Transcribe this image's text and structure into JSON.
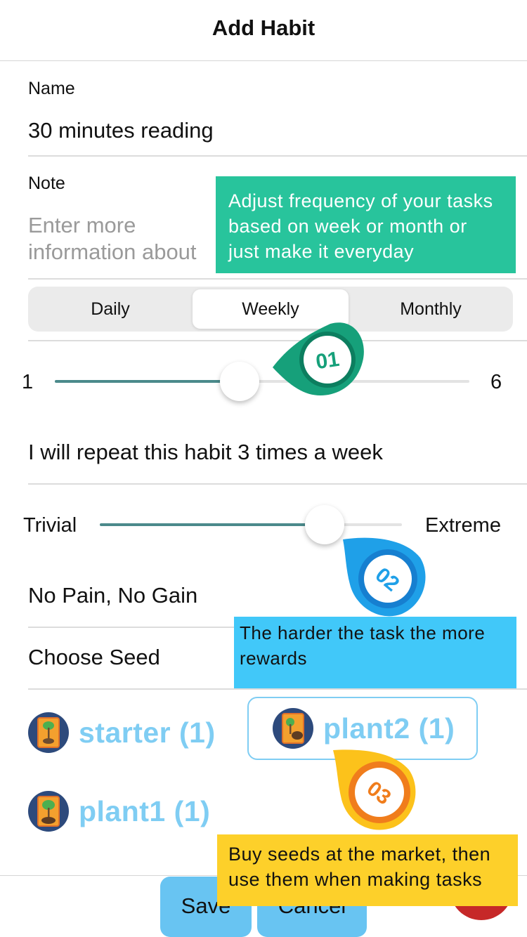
{
  "header": {
    "title": "Add Habit"
  },
  "form": {
    "name_label": "Name",
    "name_value": "30 minutes reading",
    "note_label": "Note",
    "note_placeholder": "Enter more information about yourself..."
  },
  "frequency": {
    "options": [
      "Daily",
      "Weekly",
      "Monthly"
    ],
    "selected": "Weekly"
  },
  "repeat_slider": {
    "min_label": "1",
    "max_label": "6",
    "value": 3,
    "min": 1,
    "max": 6
  },
  "repeat_text": "I will repeat this habit 3 times a week",
  "difficulty_slider": {
    "min_label": "Trivial",
    "max_label": "Extreme",
    "level": 0.75
  },
  "difficulty_text": "No Pain, No Gain",
  "seed_section": {
    "title": "Choose Seed",
    "seeds": [
      {
        "name": "starter (1)",
        "selected": false
      },
      {
        "name": "plant2 (1)",
        "selected": true
      },
      {
        "name": "plant1 (1)",
        "selected": false
      }
    ]
  },
  "actions": {
    "save_label": "Save",
    "cancel_label": "Cancel"
  },
  "tooltips": {
    "tip1": "Adjust frequency of your tasks based on week or month or just make it everyday",
    "tip2": "The harder the task the more rewards",
    "tip3": "Buy seeds at the market, then use them when making tasks",
    "badge1": "01",
    "badge2": "02",
    "badge3": "03"
  },
  "colors": {
    "accent": "#4b8a8b",
    "seed_text": "#7fcdf3",
    "tip1_bg": "#28c49c",
    "tip2_bg": "#41c8f9",
    "tip3_bg": "#fdd02a",
    "button_bg": "#68c4f2"
  }
}
